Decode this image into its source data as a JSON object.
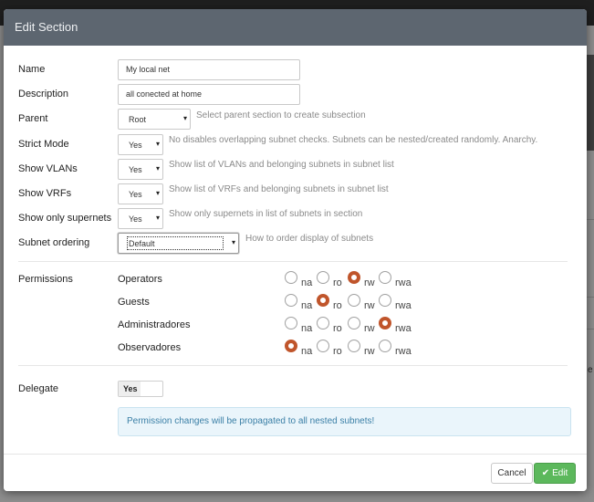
{
  "background": {
    "ellipsis_char": "e"
  },
  "modal": {
    "title": "Edit Section"
  },
  "form": {
    "name": {
      "label": "Name",
      "value": "My local net"
    },
    "description": {
      "label": "Description",
      "value": "all conected at home"
    },
    "parent": {
      "label": "Parent",
      "value": "Root",
      "help": "Select parent section to create subsection"
    },
    "strict_mode": {
      "label": "Strict Mode",
      "value": "Yes",
      "help": "No disables overlapping subnet checks. Subnets can be nested/created randomly. Anarchy."
    },
    "show_vlans": {
      "label": "Show VLANs",
      "value": "Yes",
      "help": "Show list of VLANs and belonging subnets in subnet list"
    },
    "show_vrfs": {
      "label": "Show VRFs",
      "value": "Yes",
      "help": "Show list of VRFs and belonging subnets in subnet list"
    },
    "show_supernets": {
      "label": "Show only supernets",
      "value": "Yes",
      "help": "Show only supernets in list of subnets in section"
    },
    "subnet_ordering": {
      "label": "Subnet ordering",
      "value": "Default",
      "help": "How to order display of subnets"
    }
  },
  "permissions": {
    "label": "Permissions",
    "options": [
      "na",
      "ro",
      "rw",
      "rwa"
    ],
    "groups": [
      {
        "name": "Operators",
        "selected": "rw"
      },
      {
        "name": "Guests",
        "selected": "ro"
      },
      {
        "name": "Administradores",
        "selected": "rwa"
      },
      {
        "name": "Observadores",
        "selected": "na"
      }
    ]
  },
  "delegate": {
    "label": "Delegate",
    "value": "Yes"
  },
  "alert": {
    "text": "Permission changes will be propagated to all nested subnets!"
  },
  "footer": {
    "cancel_label": "Cancel",
    "edit_label": "Edit"
  },
  "colors": {
    "header": "#5d6670",
    "radio_selected": "#c0552b",
    "edit_button": "#5cb85c",
    "alert_text": "#3a7fa6"
  },
  "icons": {
    "select_arrow": "caret-down-icon",
    "edit": "check-icon"
  }
}
